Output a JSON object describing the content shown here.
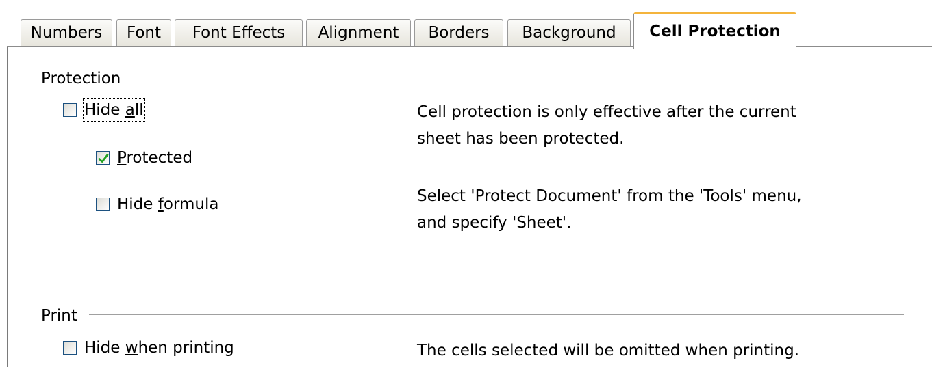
{
  "tabs": [
    {
      "label": "Numbers",
      "active": false
    },
    {
      "label": "Font",
      "active": false
    },
    {
      "label": "Font Effects",
      "active": false
    },
    {
      "label": "Alignment",
      "active": false
    },
    {
      "label": "Borders",
      "active": false
    },
    {
      "label": "Background",
      "active": false
    },
    {
      "label": "Cell Protection",
      "active": true
    }
  ],
  "protection": {
    "title": "Protection",
    "hide_all": {
      "pre": "Hide ",
      "mn": "a",
      "post": "ll",
      "checked": false,
      "focused": true
    },
    "protected": {
      "pre": "",
      "mn": "P",
      "post": "rotected",
      "checked": true
    },
    "hide_formula": {
      "pre": "Hide ",
      "mn": "f",
      "post": "ormula",
      "checked": false
    },
    "info_line1": "Cell protection is only effective after the current",
    "info_line2": "sheet has been protected.",
    "info_line3": "Select 'Protect Document' from the 'Tools' menu,",
    "info_line4": "and specify 'Sheet'."
  },
  "print": {
    "title": "Print",
    "hide_when_printing": {
      "pre": "Hide ",
      "mn": "w",
      "post": "hen printing",
      "checked": false
    },
    "info": "The cells selected will be omitted when printing."
  },
  "colors": {
    "active_tab_accent": "#f4b43c",
    "checkbox_border": "#1c5180",
    "checkmark": "#21a121"
  },
  "icons": {
    "checkmark": "checkmark-icon"
  }
}
